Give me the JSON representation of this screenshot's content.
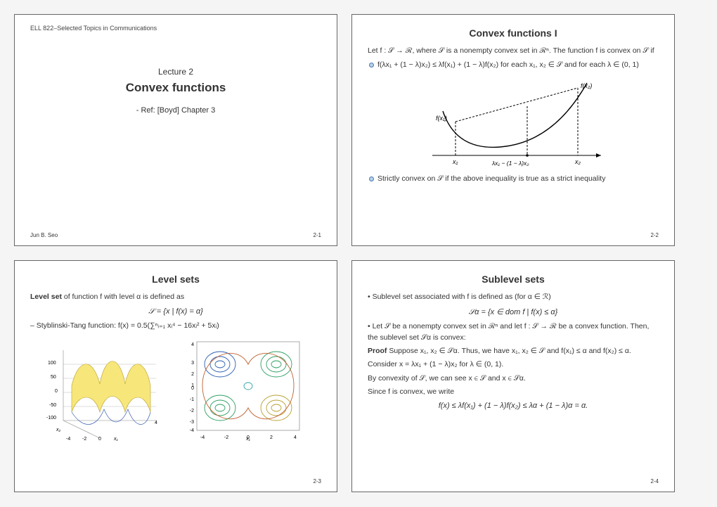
{
  "slide1": {
    "course": "ELL 822–Selected Topics in Communications",
    "lecture_num": "Lecture 2",
    "topic": "Convex functions",
    "ref": "- Ref: [Boyd] Chapter 3",
    "author": "Jun B. Seo",
    "page": "2-1"
  },
  "slide2": {
    "title": "Convex functions I",
    "intro": "Let f : 𝒮 → ℛ, where 𝒮 is a nonempty convex set in ℛⁿ. The function f is convex on 𝒮 if",
    "bullet1": "f(λx₁ + (1 − λ)x₂) ≤ λf(x₁) + (1 − λ)f(x₂) for each x₁, x₂ ∈ 𝒮 and for each λ ∈ (0, 1)",
    "bullet2": "Strictly convex on 𝒮 if the above inequality is true as a strict inequality",
    "fig_labels": {
      "fx1": "f(x₁)",
      "fx2": "f(x₂)",
      "x1": "x₁",
      "x2": "x₂",
      "mid": "λx₁ − (1 − λ)x₂"
    },
    "page": "2-2"
  },
  "slide3": {
    "title": "Level sets",
    "text1": "Level set of function f with level α is defined as",
    "eq1": "𝒮 = {x | f(x) = α}",
    "text2": "– Styblinski-Tang function: f(x) = 0.5(∑ⁿᵢ₌₁ xᵢ⁴ − 16xᵢ² + 5xᵢ)",
    "page": "2-3"
  },
  "slide4": {
    "title": "Sublevel sets",
    "bullet1": "• Sublevel set associated with f is defined as (for α ∈ ℛ)",
    "eq1": "𝒮α = {x ∈ dom f | f(x) ≤ α}",
    "bullet2": "• Let 𝒮 be a nonempty convex set in ℛⁿ and let f : 𝒮 → ℛ be a convex function. Then, the sublevel set 𝒮α is convex:",
    "proof_label": "Proof",
    "proof1": " Suppose x₁, x₂ ∈ 𝒮α. Thus, we have x₁, x₂ ∈ 𝒮 and f(x₁) ≤ α and f(x₂) ≤ α.",
    "proof2": "Consider x = λx₁ + (1 − λ)x₂ for λ ∈ (0, 1).",
    "proof3": "By convexity of 𝒮, we can see x ∈ 𝒮 and x ∈ 𝒮α.",
    "proof4": "Since f is convex, we write",
    "eq2": "f(x) ≤ λf(x₁) + (1 − λ)f(x₂) ≤ λα + (1 − λ)α = α.",
    "page": "2-4"
  }
}
